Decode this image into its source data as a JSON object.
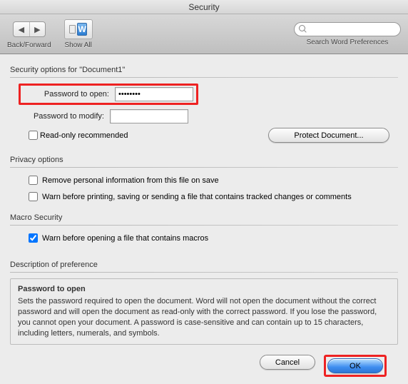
{
  "window": {
    "title": "Security"
  },
  "toolbar": {
    "back_forward_label": "Back/Forward",
    "show_all_label": "Show All",
    "w_glyph": "W",
    "search_placeholder": "",
    "search_label": "Search Word Preferences"
  },
  "security_options": {
    "group_label": "Security options for \"Document1\"",
    "password_open_label": "Password to open:",
    "password_open_value": "••••••••",
    "password_modify_label": "Password to modify:",
    "password_modify_value": "",
    "read_only_label": "Read-only recommended",
    "protect_button": "Protect Document..."
  },
  "privacy": {
    "group_label": "Privacy options",
    "remove_personal_label": "Remove personal information from this file on save",
    "warn_tracked_label": "Warn before printing, saving or sending a file that contains tracked changes or comments"
  },
  "macro": {
    "group_label": "Macro Security",
    "warn_macros_label": "Warn before opening a file that contains macros"
  },
  "description": {
    "group_label": "Description of preference",
    "title": "Password to open",
    "body": "Sets the password required to open the document. Word will not open the document without the correct password and will open the document as read-only with the correct password. If you lose the password, you cannot open your document. A password is case-sensitive and can contain up to 15 characters, including letters, numerals, and symbols."
  },
  "footer": {
    "cancel": "Cancel",
    "ok": "OK"
  }
}
